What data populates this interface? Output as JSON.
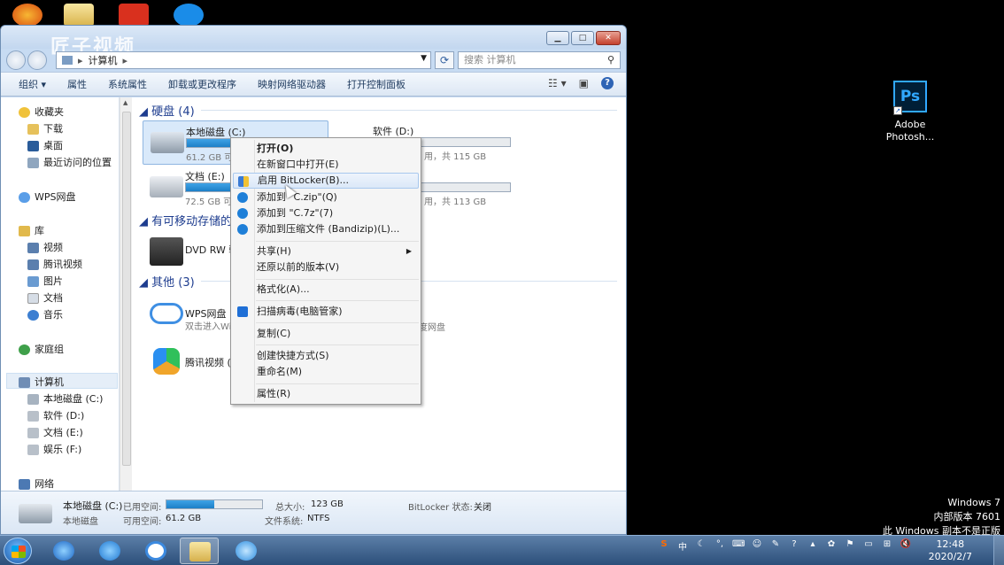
{
  "window": {
    "watermark": "匠子视频",
    "address_crumbs": [
      "计算机"
    ],
    "search_placeholder": "搜索 计算机"
  },
  "toolbar": [
    "组织 ▾",
    "属性",
    "系统属性",
    "卸载或更改程序",
    "映射网络驱动器",
    "打开控制面板"
  ],
  "sidebar": {
    "favorites": "收藏夹",
    "fav_items": [
      "下载",
      "桌面",
      "最近访问的位置"
    ],
    "wps": "WPS网盘",
    "libraries": "库",
    "lib_items": [
      "视频",
      "腾讯视频",
      "图片",
      "文档",
      "音乐"
    ],
    "homegroup": "家庭组",
    "computer": "计算机",
    "comp_items": [
      "本地磁盘 (C:)",
      "软件 (D:)",
      "文档 (E:)",
      "娱乐 (F:)"
    ],
    "network": "网络"
  },
  "groups": {
    "harddisk": "硬盘 (4)",
    "removable": "有可移动存储的设",
    "other": "其他 (3)"
  },
  "drives": [
    {
      "name": "本地磁盘 (C:)",
      "info": "61.2 GB 可",
      "fill": 0.5
    },
    {
      "name": "软件 (D:)",
      "info": "用，共 115 GB",
      "fill": 0.0
    },
    {
      "name": "文档 (E:)",
      "info": "72.5 GB 可",
      "fill": 0.4
    },
    {
      "name": "",
      "info": "用，共 113 GB",
      "fill": 0.0
    }
  ],
  "other_items": {
    "dvd": "DVD RW 驱",
    "wps_name": "WPS网盘",
    "wps_sub": "双击进入Wi",
    "wps_sub2": "度网盘",
    "tencent": "腾讯视频 (3"
  },
  "context_menu": [
    {
      "label": "打开(O)",
      "bold": true
    },
    {
      "label": "在新窗口中打开(E)"
    },
    {
      "label": "启用 BitLocker(B)...",
      "icon": "shield-icon",
      "highlighted": true
    },
    {
      "label": "添加到 \"C.zip\"(Q)",
      "icon": "bandizip-icon"
    },
    {
      "label": "添加到 \"C.7z\"(7)",
      "icon": "bandizip-icon"
    },
    {
      "label": "添加到压缩文件 (Bandizip)(L)...",
      "icon": "bandizip-icon"
    },
    {
      "label": "共享(H)",
      "submenu": true
    },
    {
      "label": "还原以前的版本(V)"
    },
    {
      "label": "格式化(A)..."
    },
    {
      "label": "扫描病毒(电脑管家)",
      "icon": "tencent-shield-icon"
    },
    {
      "label": "复制(C)"
    },
    {
      "label": "创建快捷方式(S)"
    },
    {
      "label": "重命名(M)"
    },
    {
      "label": "属性(R)"
    }
  ],
  "details": {
    "name": "本地磁盘 (C:)",
    "type": "本地磁盘",
    "used_label": "已用空间:",
    "free_label": "可用空间:",
    "free_value": "61.2 GB",
    "total_label": "总大小:",
    "total_value": "123 GB",
    "fs_label": "文件系统:",
    "fs_value": "NTFS",
    "bitlocker_label": "BitLocker 状态:",
    "bitlocker_value": "关闭",
    "used_fraction": 0.5
  },
  "desktop": {
    "ps_label_1": "Adobe",
    "ps_label_2": "Photosh...",
    "ps_text": "Ps"
  },
  "notice": [
    "Windows 7",
    "内部版本 7601",
    "此 Windows 副本不是正版"
  ],
  "clock": {
    "time": "12:48",
    "date": "2020/2/7"
  },
  "tray_ime": "中",
  "colors": {
    "accent": "#1c7fc7",
    "taskbar": "#2c4f7a"
  }
}
